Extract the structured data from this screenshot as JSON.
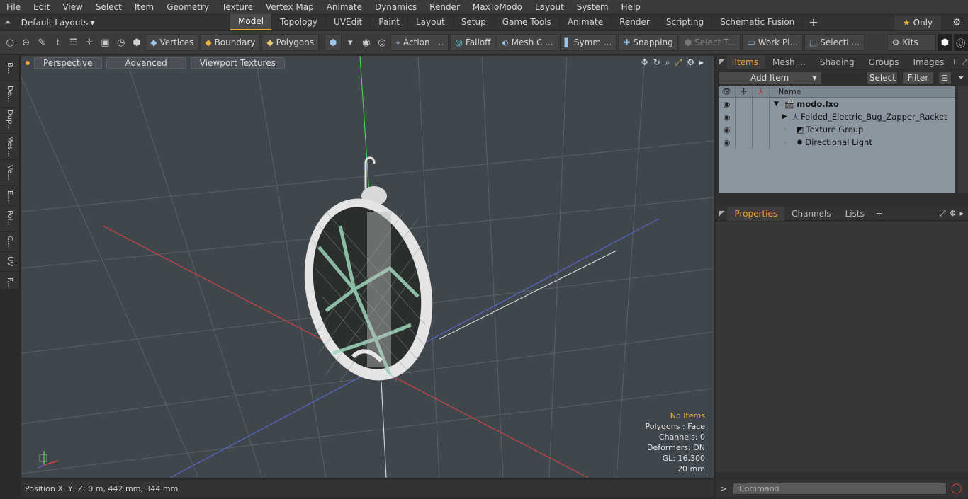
{
  "menu": [
    "File",
    "Edit",
    "View",
    "Select",
    "Item",
    "Geometry",
    "Texture",
    "Vertex Map",
    "Animate",
    "Dynamics",
    "Render",
    "MaxToModo",
    "Layout",
    "System",
    "Help"
  ],
  "layouts": {
    "label": "Default Layouts"
  },
  "tabs": [
    "Model",
    "Topology",
    "UVEdit",
    "Paint",
    "Layout",
    "Setup",
    "Game Tools",
    "Animate",
    "Render",
    "Scripting",
    "Schematic Fusion"
  ],
  "only_label": "Only",
  "toolbar": {
    "vertices": "Vertices",
    "boundary": "Boundary",
    "polygons": "Polygons",
    "action": "Action",
    "falloff": "Falloff",
    "mesh": "Mesh C ...",
    "symm": "Symm ...",
    "snapping": "Snapping",
    "select_t": "Select T...",
    "work_pl": "Work Pl...",
    "selecti": "Selecti ...",
    "kits": "Kits"
  },
  "left_tabs": [
    "B...",
    "De...",
    "Dup...",
    "Mes...",
    "Ve...",
    "E...",
    "Pol...",
    "C...",
    "UV",
    "F..."
  ],
  "viewport": {
    "perspective": "Perspective",
    "advanced": "Advanced",
    "textures": "Viewport Textures",
    "info": {
      "items": "No Items",
      "polygons": "Polygons : Face",
      "channels": "Channels: 0",
      "deformers": "Deformers: ON",
      "gl": "GL: 16,300",
      "scale": "20 mm"
    }
  },
  "status": {
    "position": "Position X, Y, Z:  0 m, 442 mm, 344 mm"
  },
  "right_tabs": [
    "Items",
    "Mesh ...",
    "Shading",
    "Groups",
    "Images"
  ],
  "add_item": "Add Item",
  "select_btn": "Select",
  "filter_btn": "Filter",
  "tree": {
    "name_header": "Name",
    "rows": [
      "modo.lxo",
      "Folded_Electric_Bug_Zapper_Racket",
      "Texture Group",
      "Directional Light"
    ]
  },
  "props_tabs": [
    "Properties",
    "Channels",
    "Lists"
  ],
  "command_placeholder": "Command",
  "colors": {
    "accent": "#e8a23a",
    "viewport_bg": "#3f464c",
    "tree_bg": "#8b96a0"
  }
}
